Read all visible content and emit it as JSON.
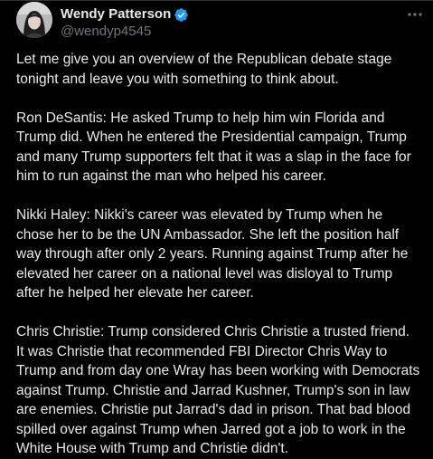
{
  "author": {
    "display_name": "Wendy Patterson",
    "handle": "@wendyp4545",
    "verified": true,
    "avatar_icon": "profile-photo",
    "verified_icon": "verified-badge-icon",
    "more_icon": "more-horizontal-icon"
  },
  "colors": {
    "background": "#000000",
    "text": "#e7e9ea",
    "secondary_text": "#71767b",
    "verified": "#1d9bf0"
  },
  "tweet": {
    "paragraphs": [
      {
        "lines": [
          "Let me give you an overview of the Republican debate stage",
          "tonight and leave you with something to think about."
        ]
      },
      {
        "lines": [
          "Ron DeSantis: He asked Trump to help him win Florida and",
          "Trump did.  When he entered the Presidential campaign, Trump",
          "and many Trump supporters felt that it was a slap in the face for",
          "him to run against the man who helped his career."
        ]
      },
      {
        "lines": [
          "Nikki Haley: Nikki's career was elevated by Trump when he",
          "chose her to be the UN Ambassador.  She left the position half",
          "way through after only 2 years. Running against Trump after he",
          "elevated her career on a national level was disloyal to Trump",
          "after he helped her elevate her career."
        ]
      },
      {
        "lines": [
          "Chris Christie: Trump considered Chris Christie a trusted friend.",
          "It was Christie that recommended FBI Director Chris Way to",
          "Trump and from day one Wray has been working with Democrats",
          "against Trump. Christie and Jarrad Kushner, Trump's son in law",
          "are enemies.  Christie put Jarrad's dad in prison.  That bad blood",
          "spilled over against Trump when Jarred got a job to work in the",
          "White House with Trump and Christie didn't."
        ]
      }
    ]
  }
}
